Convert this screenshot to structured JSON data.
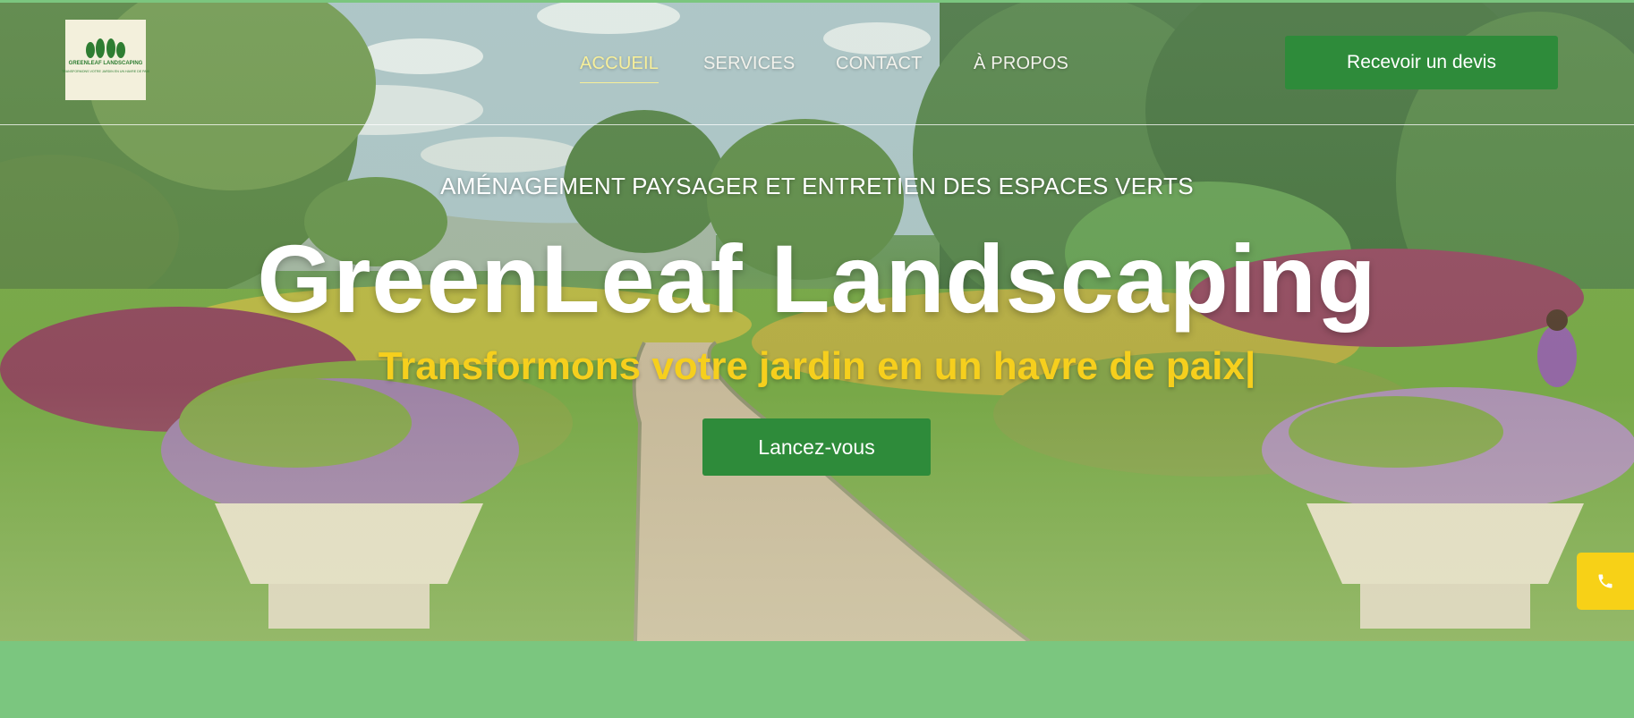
{
  "header": {
    "logo": {
      "name": "GREENLEAF LANDSCAPING",
      "tagline": "TRANSFORMONS VOTRE JARDIN EN UN HAVRE DE PAIX"
    },
    "nav": [
      {
        "label": "ACCUEIL",
        "active": true
      },
      {
        "label": "SERVICES",
        "active": false
      },
      {
        "label": "CONTACT",
        "active": false
      },
      {
        "label": "À PROPOS",
        "active": false
      }
    ],
    "quote_button": "Recevoir un devis"
  },
  "hero": {
    "kicker": "AMÉNAGEMENT PAYSAGER ET ENTRETIEN DES ESPACES VERTS",
    "title": "GreenLeaf Landscaping",
    "tagline": "Transformons votre jardin en un havre de paix|",
    "cta": "Lancez-vous"
  },
  "floating": {
    "phone_icon": "phone-icon"
  },
  "colors": {
    "brand_green": "#2e8b3a",
    "accent_yellow": "#f6cf1d",
    "band_green": "#7bc67f",
    "active_nav": "#f7ef9a"
  }
}
